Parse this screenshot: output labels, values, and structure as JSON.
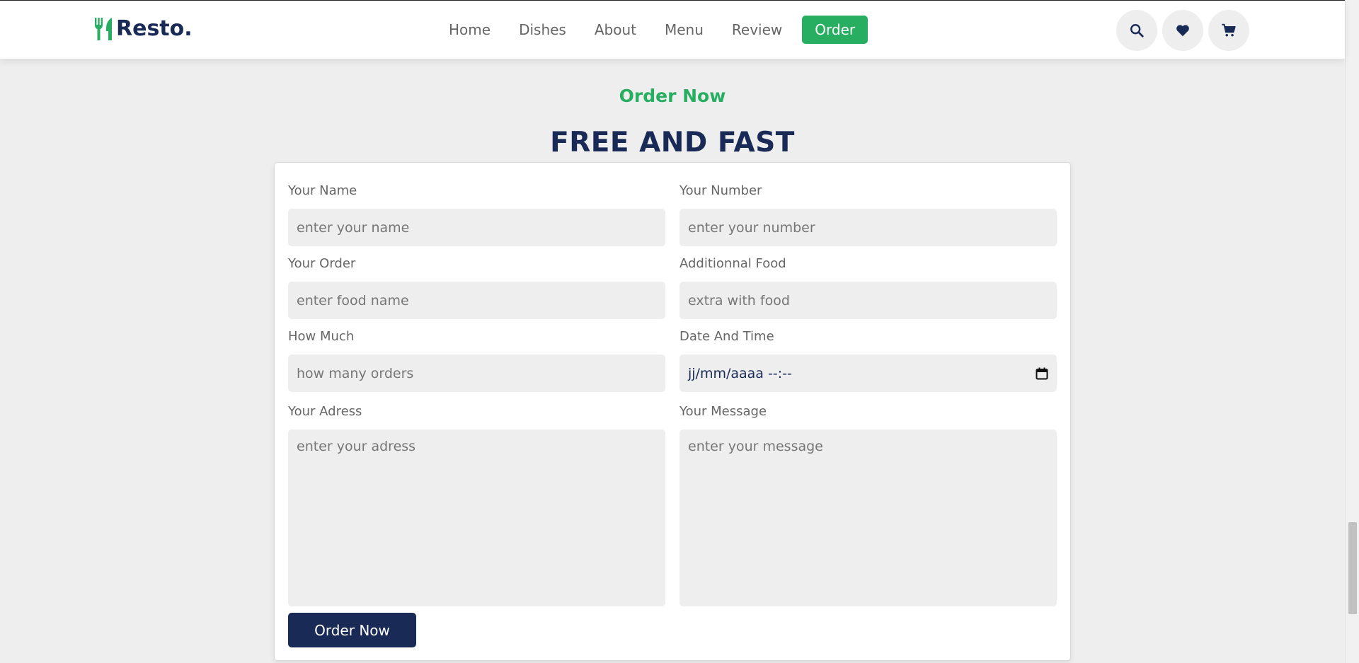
{
  "header": {
    "logo_text": "Resto.",
    "logo_icon": "utensils-icon",
    "nav": [
      {
        "label": "Home"
      },
      {
        "label": "Dishes"
      },
      {
        "label": "About"
      },
      {
        "label": "Menu"
      },
      {
        "label": "Review"
      },
      {
        "label": "Order",
        "active": true
      }
    ],
    "icons": [
      "search-icon",
      "heart-icon",
      "cart-icon"
    ]
  },
  "section": {
    "sub_heading": "Order Now",
    "heading": "FREE AND FAST"
  },
  "form": {
    "name": {
      "label": "Your Name",
      "placeholder": "enter your name"
    },
    "number": {
      "label": "Your Number",
      "placeholder": "enter your number"
    },
    "order": {
      "label": "Your Order",
      "placeholder": "enter food name"
    },
    "additional": {
      "label": "Additionnal Food",
      "placeholder": "extra with food"
    },
    "quantity": {
      "label": "How Much",
      "placeholder": "how many orders"
    },
    "datetime": {
      "label": "Date And Time",
      "value": "jj/mm/aaaa --:--",
      "icon": "calendar-icon"
    },
    "address": {
      "label": "Your Adress",
      "placeholder": "enter your adress"
    },
    "message": {
      "label": "Your Message",
      "placeholder": "enter your message"
    },
    "submit_label": "Order Now"
  },
  "colors": {
    "accent": "#27ae60",
    "primary": "#192a56",
    "muted_text": "#666666",
    "background": "#eeeeee"
  }
}
